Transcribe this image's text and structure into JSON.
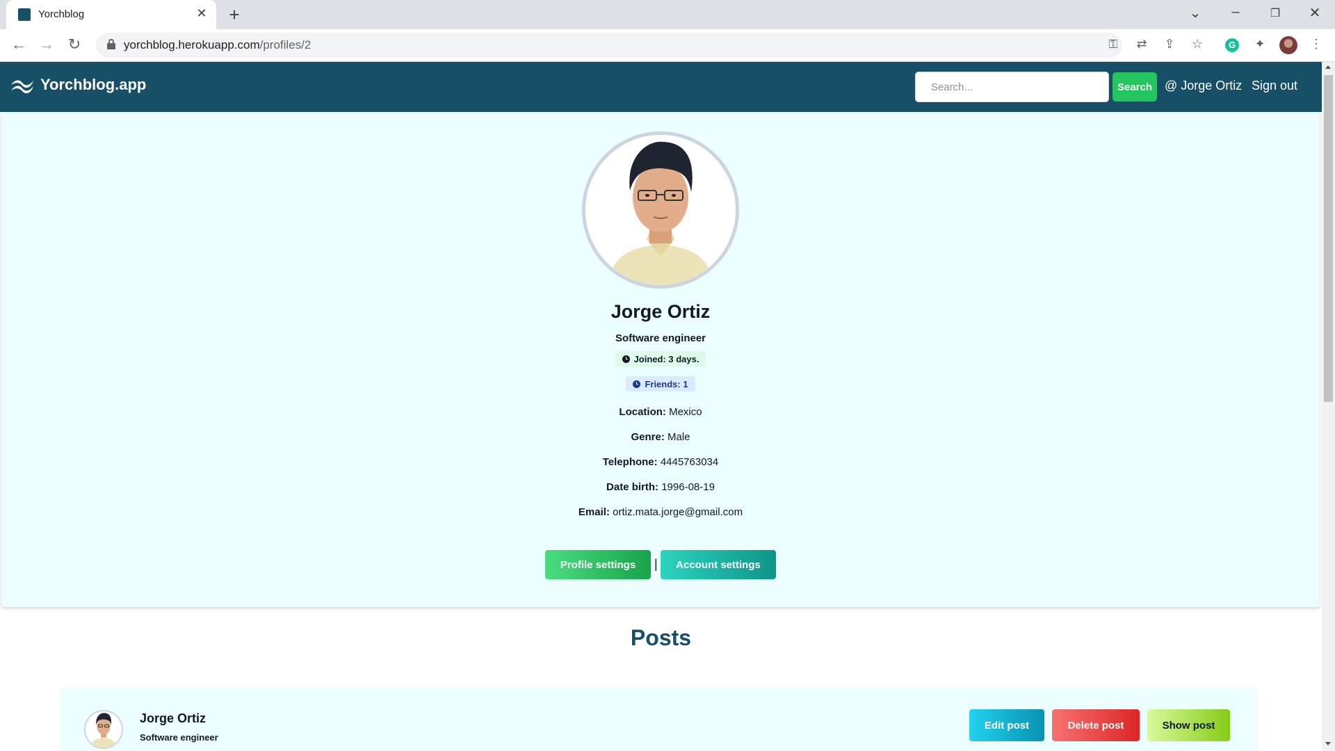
{
  "browser": {
    "tab_title": "Yorchblog",
    "url_host": "yorchblog.herokuapp.com",
    "url_path": "/profiles/2"
  },
  "navbar": {
    "brand": "Yorchblog.app",
    "search_placeholder": "Search...",
    "search_button": "Search",
    "user_link": "@ Jorge Ortiz",
    "signout": "Sign out"
  },
  "profile": {
    "name": "Jorge Ortiz",
    "title": "Software engineer",
    "joined": "Joined: 3 days.",
    "friends": "Friends: 1",
    "fields": [
      {
        "label": "Location:",
        "value": "Mexico"
      },
      {
        "label": "Genre:",
        "value": "Male"
      },
      {
        "label": "Telephone:",
        "value": "4445763034"
      },
      {
        "label": "Date birth:",
        "value": "1996-08-19"
      },
      {
        "label": "Email:",
        "value": "ortiz.mata.jorge@gmail.com"
      }
    ],
    "profile_settings": "Profile settings",
    "separator": "|",
    "account_settings": "Account settings"
  },
  "posts": {
    "heading": "Posts",
    "items": [
      {
        "author": "Jorge Ortiz",
        "role": "Software engineer",
        "edit": "Edit post",
        "delete": "Delete post",
        "show": "Show post"
      }
    ]
  },
  "colors": {
    "navbar": "#174f66",
    "card_bg": "#ecfeff",
    "search_button": "#22c55e"
  }
}
